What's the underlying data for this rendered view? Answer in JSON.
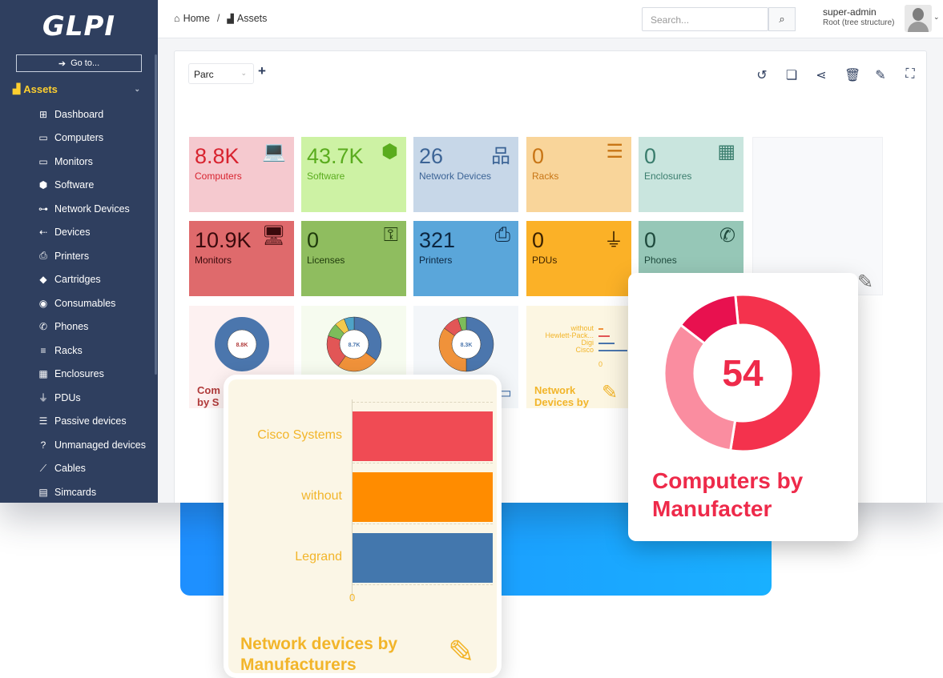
{
  "app": {
    "logo": "GLPI",
    "goto_label": "Go to..."
  },
  "sidebar": {
    "section_label": "Assets",
    "items": [
      {
        "label": "Dashboard",
        "icon": "dashboard-icon",
        "glyph": "⊞"
      },
      {
        "label": "Computers",
        "icon": "computer-icon",
        "glyph": "▭"
      },
      {
        "label": "Monitors",
        "icon": "monitor-icon",
        "glyph": "▭"
      },
      {
        "label": "Software",
        "icon": "software-icon",
        "glyph": "⬢"
      },
      {
        "label": "Network Devices",
        "icon": "network-icon",
        "glyph": "⊶"
      },
      {
        "label": "Devices",
        "icon": "devices-icon",
        "glyph": "⇠"
      },
      {
        "label": "Printers",
        "icon": "printer-icon",
        "glyph": "⎙"
      },
      {
        "label": "Cartridges",
        "icon": "cartridge-icon",
        "glyph": "◆"
      },
      {
        "label": "Consumables",
        "icon": "consumables-icon",
        "glyph": "◉"
      },
      {
        "label": "Phones",
        "icon": "phone-icon",
        "glyph": "✆"
      },
      {
        "label": "Racks",
        "icon": "rack-icon",
        "glyph": "≡"
      },
      {
        "label": "Enclosures",
        "icon": "enclosure-icon",
        "glyph": "▦"
      },
      {
        "label": "PDUs",
        "icon": "pdu-icon",
        "glyph": "⏚"
      },
      {
        "label": "Passive devices",
        "icon": "passive-device-icon",
        "glyph": "☰"
      },
      {
        "label": "Unmanaged devices",
        "icon": "question-icon",
        "glyph": "?"
      },
      {
        "label": "Cables",
        "icon": "cable-icon",
        "glyph": "⟋"
      },
      {
        "label": "Simcards",
        "icon": "simcard-icon",
        "glyph": "▤"
      }
    ]
  },
  "header": {
    "home": "Home",
    "separator": "/",
    "section": "Assets",
    "search_placeholder": "Search...",
    "user_name": "super-admin",
    "user_entity": "Root (tree structure)"
  },
  "dashboard": {
    "selected": "Parc"
  },
  "cards": [
    {
      "value": "8.8K",
      "label": "Computers",
      "bg": "#f5c9cf",
      "fg": "#d8232f",
      "icon": "laptop-icon",
      "glyph": "💻"
    },
    {
      "value": "43.7K",
      "label": "Software",
      "bg": "#cdf2a4",
      "fg": "#5aac1e",
      "icon": "cube-icon",
      "glyph": "⬢"
    },
    {
      "value": "26",
      "label": "Network Devices",
      "bg": "#c7d7e8",
      "fg": "#3c6496",
      "icon": "network-icon",
      "glyph": "品"
    },
    {
      "value": "0",
      "label": "Racks",
      "bg": "#f9d59a",
      "fg": "#c87515",
      "icon": "server-icon",
      "glyph": "☰"
    },
    {
      "value": "0",
      "label": "Enclosures",
      "bg": "#c9e5de",
      "fg": "#3a7d6d",
      "icon": "grid-icon",
      "glyph": "▦"
    },
    {
      "value": "10.9K",
      "label": "Monitors",
      "bg": "#df6a6c",
      "fg": "#3a0a0c",
      "icon": "monitor-icon",
      "glyph": "🖥"
    },
    {
      "value": "0",
      "label": "Licenses",
      "bg": "#8fbd5f",
      "fg": "#1f3a0c",
      "icon": "key-icon",
      "glyph": "⚿"
    },
    {
      "value": "321",
      "label": "Printers",
      "bg": "#5aa6da",
      "fg": "#0c2640",
      "icon": "printer-icon",
      "glyph": "⎙"
    },
    {
      "value": "0",
      "label": "PDUs",
      "bg": "#fbb127",
      "fg": "#3c2200",
      "icon": "plug-icon",
      "glyph": "⏚"
    },
    {
      "value": "0",
      "label": "Phones",
      "bg": "#96c7b7",
      "fg": "#1f4a3d",
      "icon": "phone-icon",
      "glyph": "✆"
    }
  ],
  "mini_charts": [
    {
      "center": "8.8K",
      "title_line1": "Com",
      "title_line2": "by S",
      "bg": "#fdf1f1",
      "title_color": "#b03a3a"
    },
    {
      "center": "8.7K",
      "bg": "#f6fbef"
    },
    {
      "center": "8.3K",
      "bg": "#f3f6f9"
    },
    {
      "title_line1": "Network",
      "title_line2": "Devices by",
      "bg": "#fcf6e2",
      "title_color": "#f2b52a",
      "legend": [
        "without",
        "Hewlett-Pack...",
        "Digi",
        "Cisco"
      ],
      "zero": "0"
    }
  ],
  "overlay_network": {
    "title_line1": "Network devices by",
    "title_line2": "Manufacturers",
    "axis_zero": "0",
    "chart_data": {
      "type": "bar",
      "orientation": "horizontal",
      "categories": [
        "Cisco Systems",
        "without",
        "Legrand"
      ],
      "values": [
        1,
        1,
        1
      ],
      "colors": [
        "#f04b54",
        "#ff8c00",
        "#4377ad"
      ]
    }
  },
  "overlay_computers": {
    "value": "54",
    "title_line1": "Computers by",
    "title_line2": "Manufacter",
    "chart_data": {
      "type": "pie",
      "slices": [
        {
          "value": 54,
          "color": "#f4324d"
        },
        {
          "value": 13,
          "color": "#e8114f"
        },
        {
          "value": 33,
          "color": "#fa8da0"
        }
      ]
    }
  },
  "colors": {
    "sidebar_bg": "#2f3f5f",
    "accent_yellow": "#fecf2f",
    "brand_blue": "#1e8fff",
    "red": "#ee2a4a"
  }
}
